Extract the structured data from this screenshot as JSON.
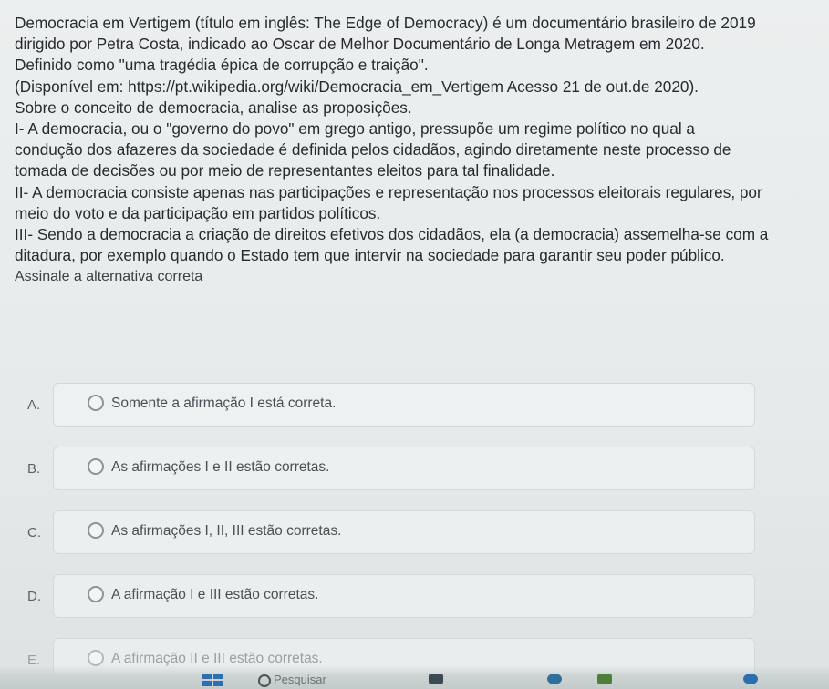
{
  "question": {
    "lines": [
      "Democracia em Vertigem (título em inglês: The Edge of Democracy) é um documentário brasileiro de 2019",
      "dirigido por Petra Costa, indicado ao Oscar de Melhor Documentário de Longa Metragem em 2020.",
      "Definido como \"uma tragédia épica de corrupção e traição\".",
      "(Disponível em: https://pt.wikipedia.org/wiki/Democracia_em_Vertigem Acesso 21 de out.de 2020).",
      "Sobre o conceito de democracia, analise as proposições.",
      "I- A democracia, ou o \"governo do povo\" em grego antigo, pressupõe um regime político no qual a",
      "condução dos afazeres da sociedade é definida pelos cidadãos, agindo diretamente neste processo de",
      "tomada de decisões ou por meio de representantes eleitos para tal finalidade.",
      "II- A democracia consiste apenas nas participações e representação nos processos eleitorais regulares, por",
      "meio do voto e da participação em partidos políticos.",
      "III- Sendo a democracia a criação de direitos efetivos dos cidadãos, ela (a democracia) assemelha-se com a",
      "ditadura, por exemplo quando o Estado tem que intervir na sociedade para garantir seu poder público."
    ],
    "instruction": "Assinale a alternativa correta"
  },
  "options": [
    {
      "letter": "A.",
      "text": "Somente a afirmação I está correta."
    },
    {
      "letter": "B.",
      "text": "As afirmações I e II estão corretas."
    },
    {
      "letter": "C.",
      "text": "As afirmações I, II, III estão corretas."
    },
    {
      "letter": "D.",
      "text": "A afirmação I e III estão corretas."
    },
    {
      "letter": "E.",
      "text": "A afirmação II e III estão corretas."
    }
  ],
  "taskbar": {
    "search_label": "Pesquisar",
    "colors": {
      "windows": "#2b6fb1",
      "app1": "#3b4a55",
      "app2": "#2f6f9e",
      "app3": "#4d7f3a"
    }
  }
}
